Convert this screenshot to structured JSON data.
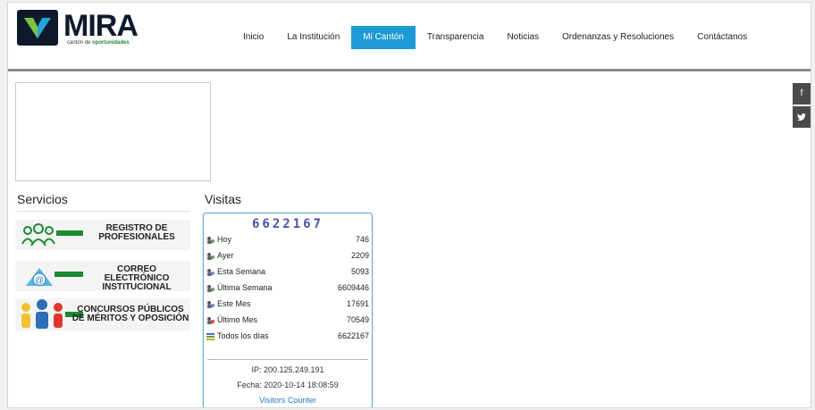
{
  "logo": {
    "text": "MIRA",
    "tagline_prefix": "cantón de ",
    "tagline_bold": "oportunidades"
  },
  "nav": {
    "items": [
      {
        "label": "Inicio"
      },
      {
        "label": "La Institución"
      },
      {
        "label": "Mi Cantón",
        "active": true
      },
      {
        "label": "Transparencia"
      },
      {
        "label": "Noticias"
      },
      {
        "label": "Ordenanzas y Resoluciones"
      },
      {
        "label": "Contáctanos"
      }
    ]
  },
  "social": {
    "facebook": "f",
    "twitter": "t"
  },
  "servicios": {
    "title": "Servicios",
    "items": [
      {
        "line1": "REGISTRO DE",
        "line2": "PROFESIONALES"
      },
      {
        "line1": "CORREO ELECTRÓNICO",
        "line2": "INSTITUCIONAL"
      },
      {
        "line1": "CONCURSOS PÚBLICOS",
        "line2": "DE MÉRITOS Y OPOSICIÓN"
      }
    ]
  },
  "visitas": {
    "title": "Visitas",
    "total": "6622167",
    "rows": [
      {
        "label": "Hoy",
        "value": "746"
      },
      {
        "label": "Ayer",
        "value": "2209"
      },
      {
        "label": "Esta Semana",
        "value": "5093"
      },
      {
        "label": "Última Semana",
        "value": "6609446"
      },
      {
        "label": "Este Mes",
        "value": "17691"
      },
      {
        "label": "Último Mes",
        "value": "70549"
      },
      {
        "label": "Todos los días",
        "value": "6622167"
      }
    ],
    "ip": "IP: 200.125.249.191",
    "fecha": "Fecha: 2020-10-14 18:08:59",
    "link": "Visitors Counter"
  },
  "colors": {
    "accent": "#1e9ad6",
    "brand_green": "#1b8a2e",
    "counter_digits": "#4a52a8"
  }
}
